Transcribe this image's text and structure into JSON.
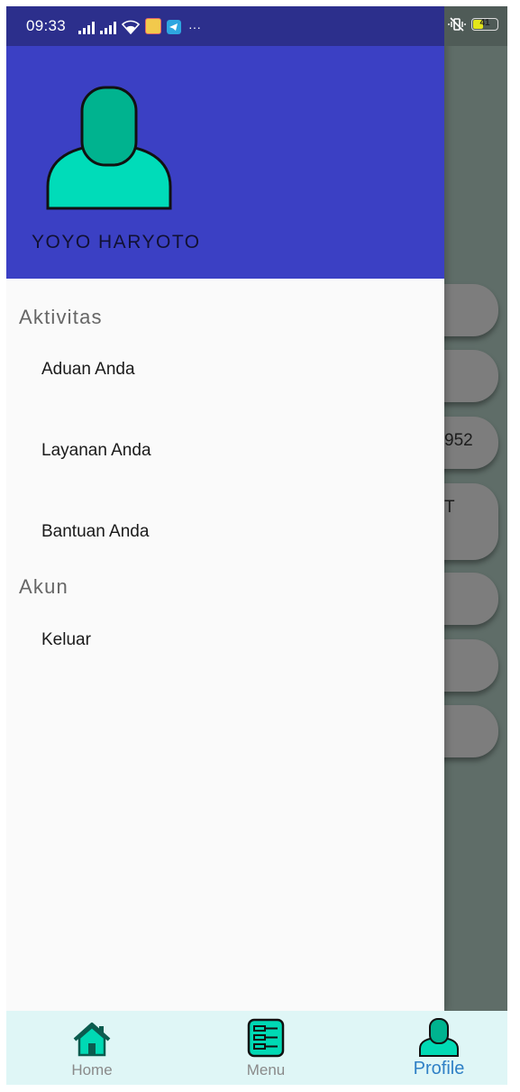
{
  "status_bar": {
    "time": "09:33",
    "battery": "41",
    "dots": "···"
  },
  "drawer": {
    "user_name": "YOYO HARYOTO",
    "sections": [
      {
        "title": "Aktivitas",
        "items": [
          "Aduan Anda",
          "Layanan Anda",
          "Bantuan Anda"
        ]
      },
      {
        "title": "Akun",
        "items": [
          "Keluar"
        ]
      }
    ]
  },
  "background_page": {
    "card_texts": [
      "",
      "",
      "952",
      "T",
      "",
      "",
      ""
    ]
  },
  "bottom_nav": {
    "items": [
      {
        "label": "Home",
        "icon": "home-icon"
      },
      {
        "label": "Menu",
        "icon": "menu-list-icon"
      },
      {
        "label": "Profile",
        "icon": "profile-icon"
      }
    ],
    "active": "Profile"
  },
  "colors": {
    "header": "#3b40c4",
    "status_bar": "#2c2f8c",
    "accent": "#00d9b4",
    "nav_background": "#dff6f6",
    "active_label": "#2f80c6"
  }
}
